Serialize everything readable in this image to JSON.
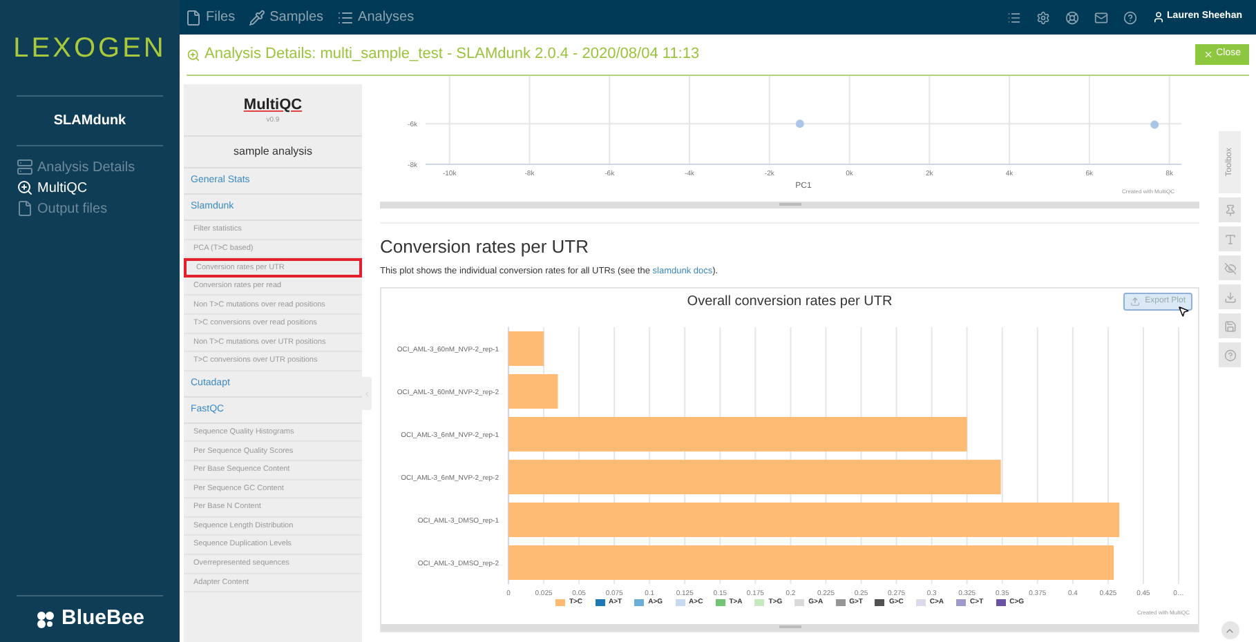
{
  "brand": {
    "logo": "LEXOGEN",
    "app": "SLAMdunk",
    "footer_logo": "BlueBee"
  },
  "sidebar": {
    "items": [
      {
        "label": "Analysis Details",
        "kind": "details",
        "selected": false
      },
      {
        "label": "MultiQC",
        "kind": "multiqc",
        "selected": true
      },
      {
        "label": "Output files",
        "kind": "files",
        "selected": false
      }
    ]
  },
  "top_nav": {
    "items": [
      {
        "label": "Files",
        "kind": "files"
      },
      {
        "label": "Samples",
        "kind": "samples"
      },
      {
        "label": "Analyses",
        "kind": "analyses"
      }
    ],
    "user": "Lauren Sheehan"
  },
  "header": {
    "title": "Analysis Details: multi_sample_test - SLAMdunk 2.0.4 - 2020/08/04 11:13",
    "close": "Close"
  },
  "report_nav": {
    "logo": "MultiQC",
    "version": "v0.9",
    "report_title": "sample analysis",
    "sections": [
      {
        "label": "General Stats"
      },
      {
        "label": "Slamdunk",
        "children": [
          {
            "label": "Filter statistics",
            "selected": false
          },
          {
            "label": "PCA (T>C based)",
            "selected": false
          },
          {
            "label": "Conversion rates per UTR",
            "selected": true
          },
          {
            "label": "Conversion rates per read",
            "selected": false
          },
          {
            "label": "Non T>C mutations over read positions",
            "selected": false
          },
          {
            "label": "T>C conversions over read positions",
            "selected": false
          },
          {
            "label": "Non T>C mutations over UTR positions",
            "selected": false
          },
          {
            "label": "T>C conversions over UTR positions",
            "selected": false
          }
        ]
      },
      {
        "label": "Cutadapt"
      },
      {
        "label": "FastQC",
        "children": [
          {
            "label": "Sequence Quality Histograms",
            "selected": false
          },
          {
            "label": "Per Sequence Quality Scores",
            "selected": false
          },
          {
            "label": "Per Base Sequence Content",
            "selected": false
          },
          {
            "label": "Per Sequence GC Content",
            "selected": false
          },
          {
            "label": "Per Base N Content",
            "selected": false
          },
          {
            "label": "Sequence Length Distribution",
            "selected": false
          },
          {
            "label": "Sequence Duplication Levels",
            "selected": false
          },
          {
            "label": "Overrepresented sequences",
            "selected": false
          },
          {
            "label": "Adapter Content",
            "selected": false
          }
        ]
      }
    ]
  },
  "pca_plot": {
    "credit": "Created with MultiQC",
    "chart_data": {
      "type": "scatter",
      "grid": true,
      "xlabel": "PC1",
      "x": [
        -1240,
        7630
      ],
      "series": [
        {
          "color": "#a9c6e8",
          "values": [
            -6000,
            -6050
          ]
        }
      ],
      "xlim": [
        -10600,
        8300
      ],
      "ylim": [
        -8000,
        -3650
      ],
      "xticks": [
        {
          "value": -10000,
          "label": "-10k"
        },
        {
          "value": -8000,
          "label": "-8k"
        },
        {
          "value": -6000,
          "label": "-6k"
        },
        {
          "value": -4000,
          "label": "-4k"
        },
        {
          "value": -2000,
          "label": "-2k"
        },
        {
          "value": 0,
          "label": "0k"
        },
        {
          "value": 2000,
          "label": "2k"
        },
        {
          "value": 4000,
          "label": "4k"
        },
        {
          "value": 6000,
          "label": "6k"
        },
        {
          "value": 8000,
          "label": "8k"
        }
      ],
      "yticks": [
        {
          "value": -6000,
          "label": "-6k"
        },
        {
          "value": -8000,
          "label": "-8k"
        }
      ]
    }
  },
  "section": {
    "heading": "Conversion rates per UTR",
    "description_before": "This plot shows the individual conversion rates for all UTRs (see the ",
    "link": "slamdunk docs",
    "description_after": ")."
  },
  "conversion_plot": {
    "export": "Export Plot",
    "credit": "Created with MultiQC",
    "chart_data": {
      "type": "bar",
      "grid": true,
      "orientation": "horizontal",
      "stacked": true,
      "title": "Overall conversion rates per UTR",
      "categories": [
        "OCI_AML-3_60nM_NVP-2_rep-1",
        "OCI_AML-3_60nM_NVP-2_rep-2",
        "OCI_AML-3_6nM_NVP-2_rep-1",
        "OCI_AML-3_6nM_NVP-2_rep-2",
        "OCI_AML-3_DMSO_rep-1",
        "OCI_AML-3_DMSO_rep-2"
      ],
      "series": [
        {
          "name": "T>C",
          "color": "#fdbb74",
          "values": [
            0.025,
            0.035,
            0.325,
            0.349,
            0.433,
            0.429
          ]
        },
        {
          "name": "A>T",
          "color": "#1f78b4",
          "values": [
            0,
            0,
            0,
            0,
            0,
            0
          ]
        },
        {
          "name": "A>G",
          "color": "#6baed6",
          "values": [
            0,
            0,
            0,
            0,
            0,
            0
          ]
        },
        {
          "name": "A>C",
          "color": "#c6dbef",
          "values": [
            0,
            0,
            0,
            0,
            0,
            0
          ]
        },
        {
          "name": "T>A",
          "color": "#74c476",
          "values": [
            0,
            0,
            0,
            0,
            0,
            0
          ]
        },
        {
          "name": "T>G",
          "color": "#c7e9c0",
          "values": [
            0,
            0,
            0,
            0,
            0,
            0
          ]
        },
        {
          "name": "G>A",
          "color": "#d9d9d9",
          "values": [
            0,
            0,
            0,
            0,
            0,
            0
          ]
        },
        {
          "name": "G>T",
          "color": "#969696",
          "values": [
            0,
            0,
            0,
            0,
            0,
            0
          ]
        },
        {
          "name": "G>C",
          "color": "#525252",
          "values": [
            0,
            0,
            0,
            0,
            0,
            0
          ]
        },
        {
          "name": "C>A",
          "color": "#dadaeb",
          "values": [
            0,
            0,
            0,
            0,
            0,
            0
          ]
        },
        {
          "name": "C>T",
          "color": "#9e9ac8",
          "values": [
            0,
            0,
            0,
            0,
            0,
            0
          ]
        },
        {
          "name": "C>G",
          "color": "#6a51a3",
          "values": [
            0,
            0,
            0,
            0,
            0,
            0
          ]
        }
      ],
      "xlim": [
        0,
        0.475
      ],
      "xticks": [
        0,
        0.025,
        0.05,
        0.075,
        0.1,
        0.125,
        0.15,
        0.175,
        0.2,
        0.225,
        0.25,
        0.275,
        0.3,
        0.325,
        0.35,
        0.375,
        0.4,
        0.425,
        0.45,
        {
          "value": 0.475,
          "label": "0…"
        }
      ]
    }
  },
  "toolbox": {
    "label": "Toolbox"
  }
}
